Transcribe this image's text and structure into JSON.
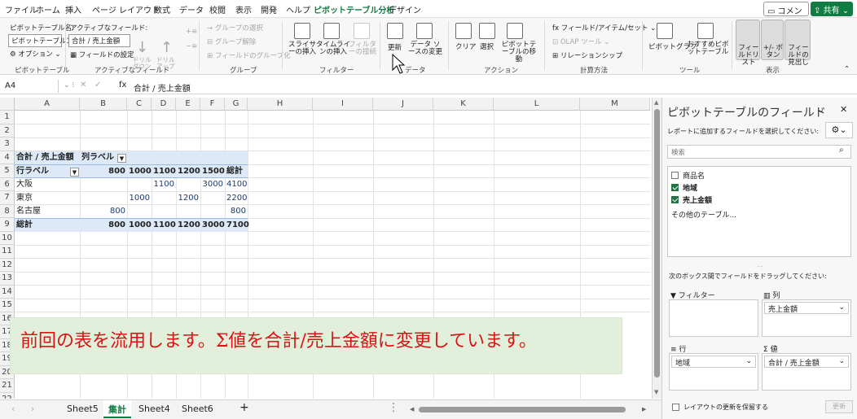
{
  "menu_tabs": [
    "ファイル",
    "ホーム",
    "挿入",
    "ページ レイアウト",
    "数式",
    "データ",
    "校閲",
    "表示",
    "開発",
    "ヘルプ",
    "ピボットテーブル分析",
    "デザイン"
  ],
  "header": {
    "comment": "コメント",
    "share": "共有"
  },
  "ribbon": {
    "pt_name_label": "ピボットテーブル名:",
    "pt_name_value": "ピボットテーブル1",
    "options": "オプション",
    "group_pt": "ピボットテーブル",
    "active_field_label": "アクティブなフィールド:",
    "active_field_value": "合計 / 売上金額",
    "field_settings": "フィールドの設定",
    "drill_down": "ドリル ダウン",
    "drill_up": "ドリル アップ",
    "group_active": "アクティブなフィールド",
    "group_select": "→ グループの選択",
    "ungroup": "グループ解除",
    "group_field": "フィールドのグループ化",
    "group_group": "グループ",
    "slicer": "スライサーの挿入",
    "timeline": "タイムラインの挿入",
    "filter_conn": "フィルターの接続",
    "group_filter": "フィルター",
    "refresh": "更新",
    "change_source": "データ ソースの変更",
    "group_data": "データ",
    "clear": "クリア",
    "select": "選択",
    "move_pt": "ピボットテーブルの移動",
    "group_action": "アクション",
    "fields_items": "フィールド/アイテム/セット",
    "olap": "OLAP ツール",
    "relationships": "リレーションシップ",
    "group_calc": "計算方法",
    "pivot_chart": "ピボットグラフ",
    "recommended": "おすすめピボットテーブル",
    "group_tools": "ツール",
    "field_list": "フィールドリスト",
    "plus_minus": "+/- ボタン",
    "field_headers": "フィールドの見出し",
    "group_show": "表示"
  },
  "formula_bar": {
    "name_box": "A4",
    "fx": "fx",
    "formula": "合計 / 売上金額"
  },
  "columns": [
    "A",
    "B",
    "C",
    "D",
    "E",
    "F",
    "G",
    "H",
    "I",
    "J",
    "K",
    "L",
    "M"
  ],
  "rows": [
    "1",
    "2",
    "3",
    "4",
    "5",
    "6",
    "7",
    "8",
    "9",
    "10",
    "11",
    "12",
    "13",
    "14",
    "15",
    "16",
    "17",
    "18",
    "19",
    "20",
    "21",
    "22"
  ],
  "pivot": {
    "values_label": "合計 / 売上金額",
    "col_label": "列ラベル",
    "row_label": "行ラベル",
    "col_headers": [
      "800",
      "1000",
      "1100",
      "1200",
      "1500",
      "総計"
    ],
    "row_items": [
      {
        "name": "大阪",
        "values": [
          "",
          "",
          "1100",
          "",
          "3000",
          "4100"
        ]
      },
      {
        "name": "東京",
        "values": [
          "",
          "1000",
          "",
          "1200",
          "",
          "2200"
        ]
      },
      {
        "name": "名古屋",
        "values": [
          "800",
          "",
          "",
          "",
          "",
          "800"
        ]
      }
    ],
    "total_label": "総計",
    "totals": [
      "800",
      "1000",
      "1100",
      "1200",
      "3000",
      "7100"
    ]
  },
  "note": "前回の表を流用します。Σ値を合計/売上金額に変更しています。",
  "sheet_tabs": [
    "Sheet5",
    "集計",
    "Sheet4",
    "Sheet6"
  ],
  "panel": {
    "title": "ピボットテーブルのフィールド",
    "subtitle": "レポートに追加するフィールドを選択してください:",
    "search_placeholder": "検索",
    "fields": [
      {
        "name": "商品名",
        "checked": false
      },
      {
        "name": "地域",
        "checked": true
      },
      {
        "name": "売上金額",
        "checked": true
      }
    ],
    "more_tables": "その他のテーブル...",
    "drag_hint": "次のボックス間でフィールドをドラッグしてください:",
    "filter_area": "フィルター",
    "column_area": "列",
    "row_area": "行",
    "value_area": "値",
    "column_chip": "売上金額",
    "row_chip": "地域",
    "value_chip": "合計 / 売上金額",
    "defer": "レイアウトの更新を保留する",
    "update": "更新"
  }
}
